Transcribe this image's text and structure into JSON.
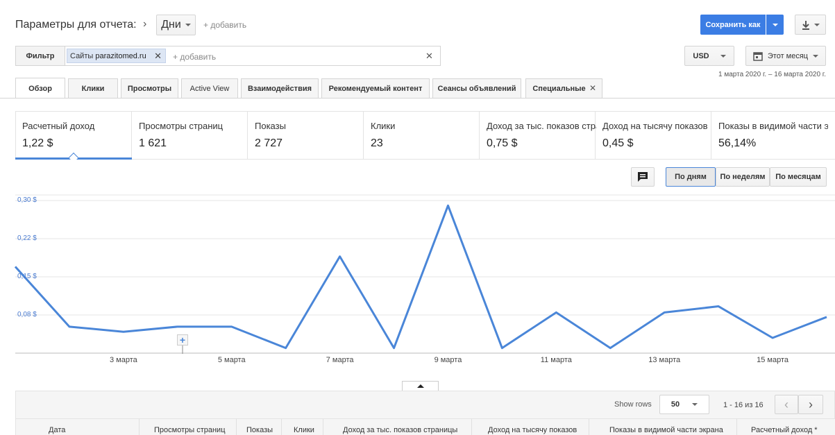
{
  "header": {
    "title": "Параметры для отчета:",
    "dimension": "Дни",
    "add_label": "+ добавить",
    "save_as": "Сохранить как"
  },
  "filter": {
    "label": "Фильтр",
    "chip_prefix": "Сайты",
    "chip_value": "parazitomed.ru",
    "add_label": "+ добавить"
  },
  "currency": "USD",
  "date_range": {
    "label": "Этот месяц",
    "range_text": "1 марта 2020 г. – 16 марта 2020 г."
  },
  "tabs": [
    {
      "label": "Обзор"
    },
    {
      "label": "Клики"
    },
    {
      "label": "Просмотры"
    },
    {
      "label": "Active View"
    },
    {
      "label": "Взаимодействия"
    },
    {
      "label": "Рекомендуемый контент"
    },
    {
      "label": "Сеансы объявлений"
    },
    {
      "label": "Специальные"
    }
  ],
  "metrics": [
    {
      "label": "Расчетный доход",
      "value": "1,22 $"
    },
    {
      "label": "Просмотры страниц",
      "value": "1 621"
    },
    {
      "label": "Показы",
      "value": "2 727"
    },
    {
      "label": "Клики",
      "value": "23"
    },
    {
      "label": "Доход за тыс. показов страницы",
      "value": "0,75 $"
    },
    {
      "label": "Доход на тысячу показов",
      "value": "0,45 $"
    },
    {
      "label": "Показы в видимой части экрана",
      "value": "56,14%"
    }
  ],
  "granularity": {
    "day": "По дням",
    "week": "По неделям",
    "month": "По месяцам"
  },
  "chart_data": {
    "type": "line",
    "x": [
      1,
      2,
      3,
      4,
      5,
      6,
      7,
      8,
      9,
      10,
      11,
      12,
      13,
      14,
      15,
      16
    ],
    "values": [
      0.17,
      0.052,
      0.042,
      0.052,
      0.052,
      0.01,
      0.19,
      0.01,
      0.29,
      0.01,
      0.08,
      0.01,
      0.08,
      0.092,
      0.03,
      0.071
    ],
    "yticks": [
      "0,30 $",
      "0,22 $",
      "0,15 $",
      "0,08 $"
    ],
    "ytick_values": [
      0.3,
      0.225,
      0.15,
      0.075
    ],
    "ylim": [
      0,
      0.3
    ],
    "xticks": [
      "3 марта",
      "5 марта",
      "7 марта",
      "9 марта",
      "11 марта",
      "13 марта",
      "15 марта"
    ],
    "xtick_days": [
      3,
      5,
      7,
      9,
      11,
      13,
      15
    ],
    "grid": true,
    "color": "#4a86d8"
  },
  "table": {
    "show_rows_label": "Show rows",
    "rows_value": "50",
    "pagination": "1 - 16 из 16",
    "columns": [
      "Дата",
      "Просмотры страниц",
      "Показы",
      "Клики",
      "Доход за тыс. показов страницы",
      "Доход на тысячу показов",
      "Показы в видимой части экрана",
      "Расчетный доход *"
    ]
  },
  "colors": {
    "accent": "#3b7de4",
    "line": "#4a86d8"
  }
}
